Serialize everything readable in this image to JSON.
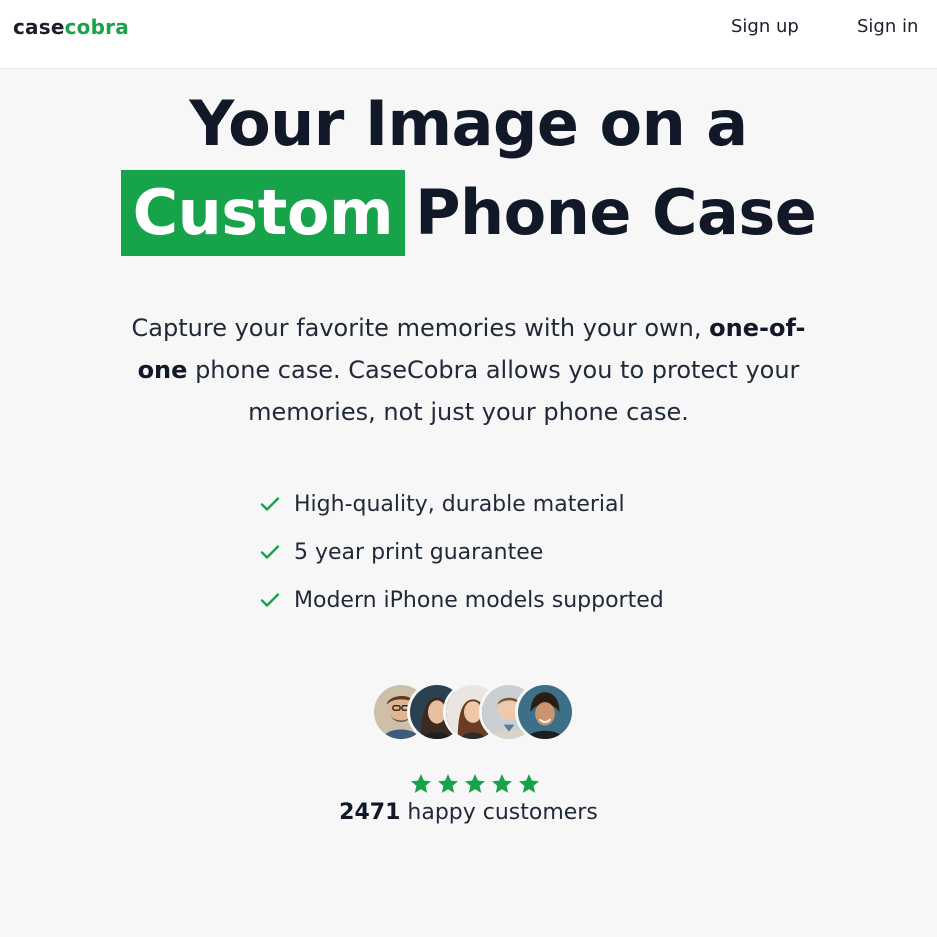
{
  "nav": {
    "logo_part1": "case",
    "logo_part2": "cobra",
    "signup": "Sign up",
    "signin": "Sign in"
  },
  "hero": {
    "title_line1": "Your Image on a",
    "title_highlight": "Custom",
    "title_rest": "Phone Case",
    "subtitle_part1": "Capture your favorite memories with your own,",
    "subtitle_bold": "one-of-one",
    "subtitle_part2": "phone case. CaseCobra allows you to protect your memories, not just your phone case."
  },
  "features": [
    "High-quality, durable material",
    "5 year print guarantee",
    "Modern iPhone models supported"
  ],
  "social_proof": {
    "rating_stars": 5,
    "count": "2471",
    "label": "happy customers"
  },
  "colors": {
    "accent": "#16a34a",
    "text": "#111827",
    "background": "#f7f7f8"
  },
  "icons": {
    "check": "check-icon",
    "star": "star-icon"
  }
}
